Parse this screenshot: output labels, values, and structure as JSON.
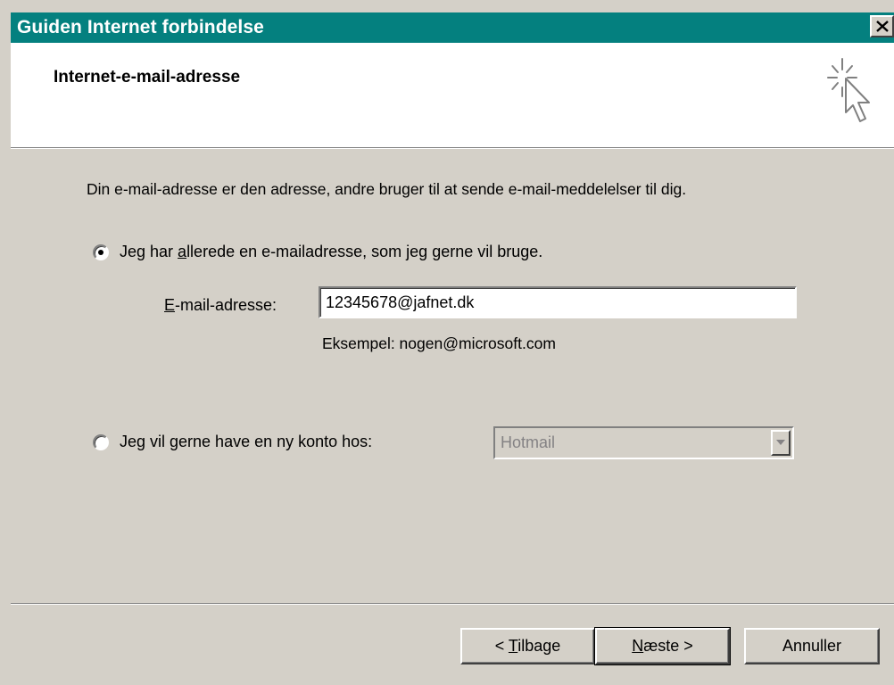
{
  "window": {
    "title": "Guiden Internet forbindelse",
    "close_icon": "close-icon"
  },
  "header": {
    "title": "Internet-e-mail-adresse",
    "icon": "wizard-cursor-icon"
  },
  "main": {
    "description": "Din e-mail-adresse er den adresse, andre bruger til at sende e-mail-meddelelser til dig.",
    "option_existing": {
      "pre": "Jeg har ",
      "mnemonic": "a",
      "post": "llerede en e-mailadresse, som jeg gerne vil bruge.",
      "selected": true
    },
    "email_label": {
      "mnemonic": "E",
      "post": "-mail-adresse:"
    },
    "email_value": "12345678@jafnet.dk",
    "example": "Eksempel: nogen@microsoft.com",
    "option_new": {
      "label": "Jeg vil gerne have en ny konto hos:",
      "selected": false
    },
    "provider_select": {
      "value": "Hotmail",
      "enabled": false
    }
  },
  "buttons": {
    "back": {
      "pre": "< ",
      "mnemonic": "T",
      "post": "ilbage"
    },
    "next": {
      "mnemonic": "N",
      "post": "æste >"
    },
    "cancel": {
      "label": "Annuller"
    }
  },
  "colors": {
    "titlebar": "#04807f",
    "dialog_bg": "#d4d0c8",
    "disabled_text": "#848284"
  }
}
